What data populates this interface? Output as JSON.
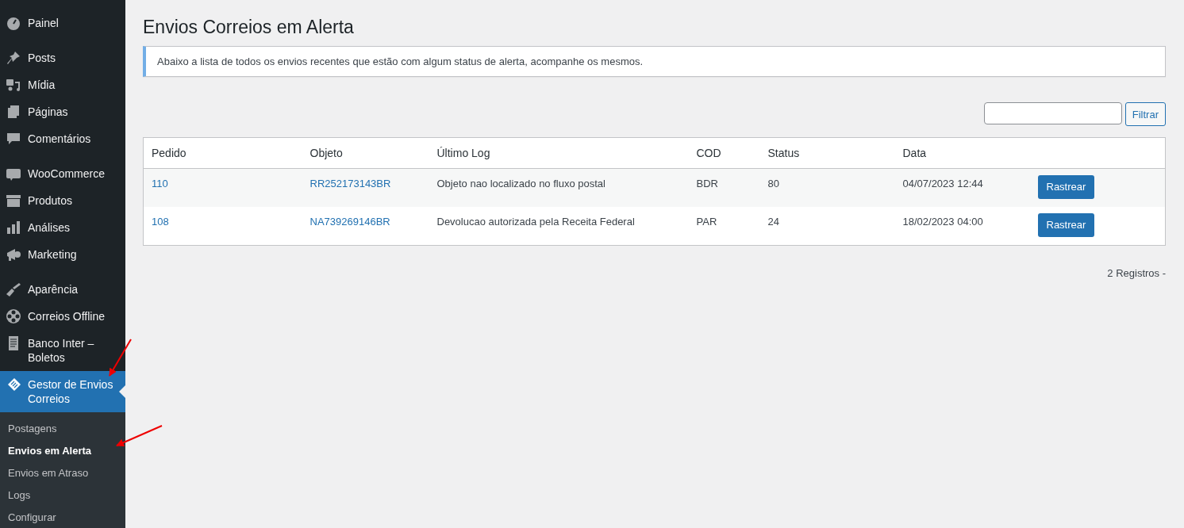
{
  "sidebar": {
    "groups": [
      [
        {
          "label": "Painel",
          "selected": false
        }
      ],
      [
        {
          "label": "Posts",
          "selected": false
        },
        {
          "label": "Mídia",
          "selected": false
        },
        {
          "label": "Páginas",
          "selected": false
        },
        {
          "label": "Comentários",
          "selected": false
        }
      ],
      [
        {
          "label": "WooCommerce",
          "selected": false
        },
        {
          "label": "Produtos",
          "selected": false
        },
        {
          "label": "Análises",
          "selected": false
        },
        {
          "label": "Marketing",
          "selected": false
        }
      ],
      [
        {
          "label": "Aparência",
          "selected": false
        },
        {
          "label": "Correios Offline",
          "selected": false
        },
        {
          "label": "Banco Inter – Boletos",
          "selected": false
        },
        {
          "label": "Gestor de Envios Correios",
          "selected": true
        }
      ]
    ],
    "submenu": [
      {
        "label": "Postagens",
        "selected": false
      },
      {
        "label": "Envios em Alerta",
        "selected": true
      },
      {
        "label": "Envios em Atraso",
        "selected": false
      },
      {
        "label": "Logs",
        "selected": false
      },
      {
        "label": "Configurar",
        "selected": false
      }
    ]
  },
  "page": {
    "title": "Envios Correios em Alerta",
    "notice": "Abaixo a lista de todos os envios recentes que estão com algum status de alerta, acompanhe os mesmos.",
    "filter_button": "Filtrar"
  },
  "table": {
    "columns": [
      "Pedido",
      "Objeto",
      "Último Log",
      "COD",
      "Status",
      "Data"
    ],
    "rows": [
      {
        "pedido": "110",
        "objeto": "RR252173143BR",
        "ultimo_log": "Objeto nao localizado no fluxo postal",
        "cod": "BDR",
        "status": "80",
        "data": "04/07/2023 12:44",
        "action": "Rastrear"
      },
      {
        "pedido": "108",
        "objeto": "NA739269146BR",
        "ultimo_log": "Devolucao autorizada pela Receita Federal",
        "cod": "PAR",
        "status": "24",
        "data": "18/02/2023 04:00",
        "action": "Rastrear"
      }
    ]
  },
  "footer": "2 Registros -"
}
